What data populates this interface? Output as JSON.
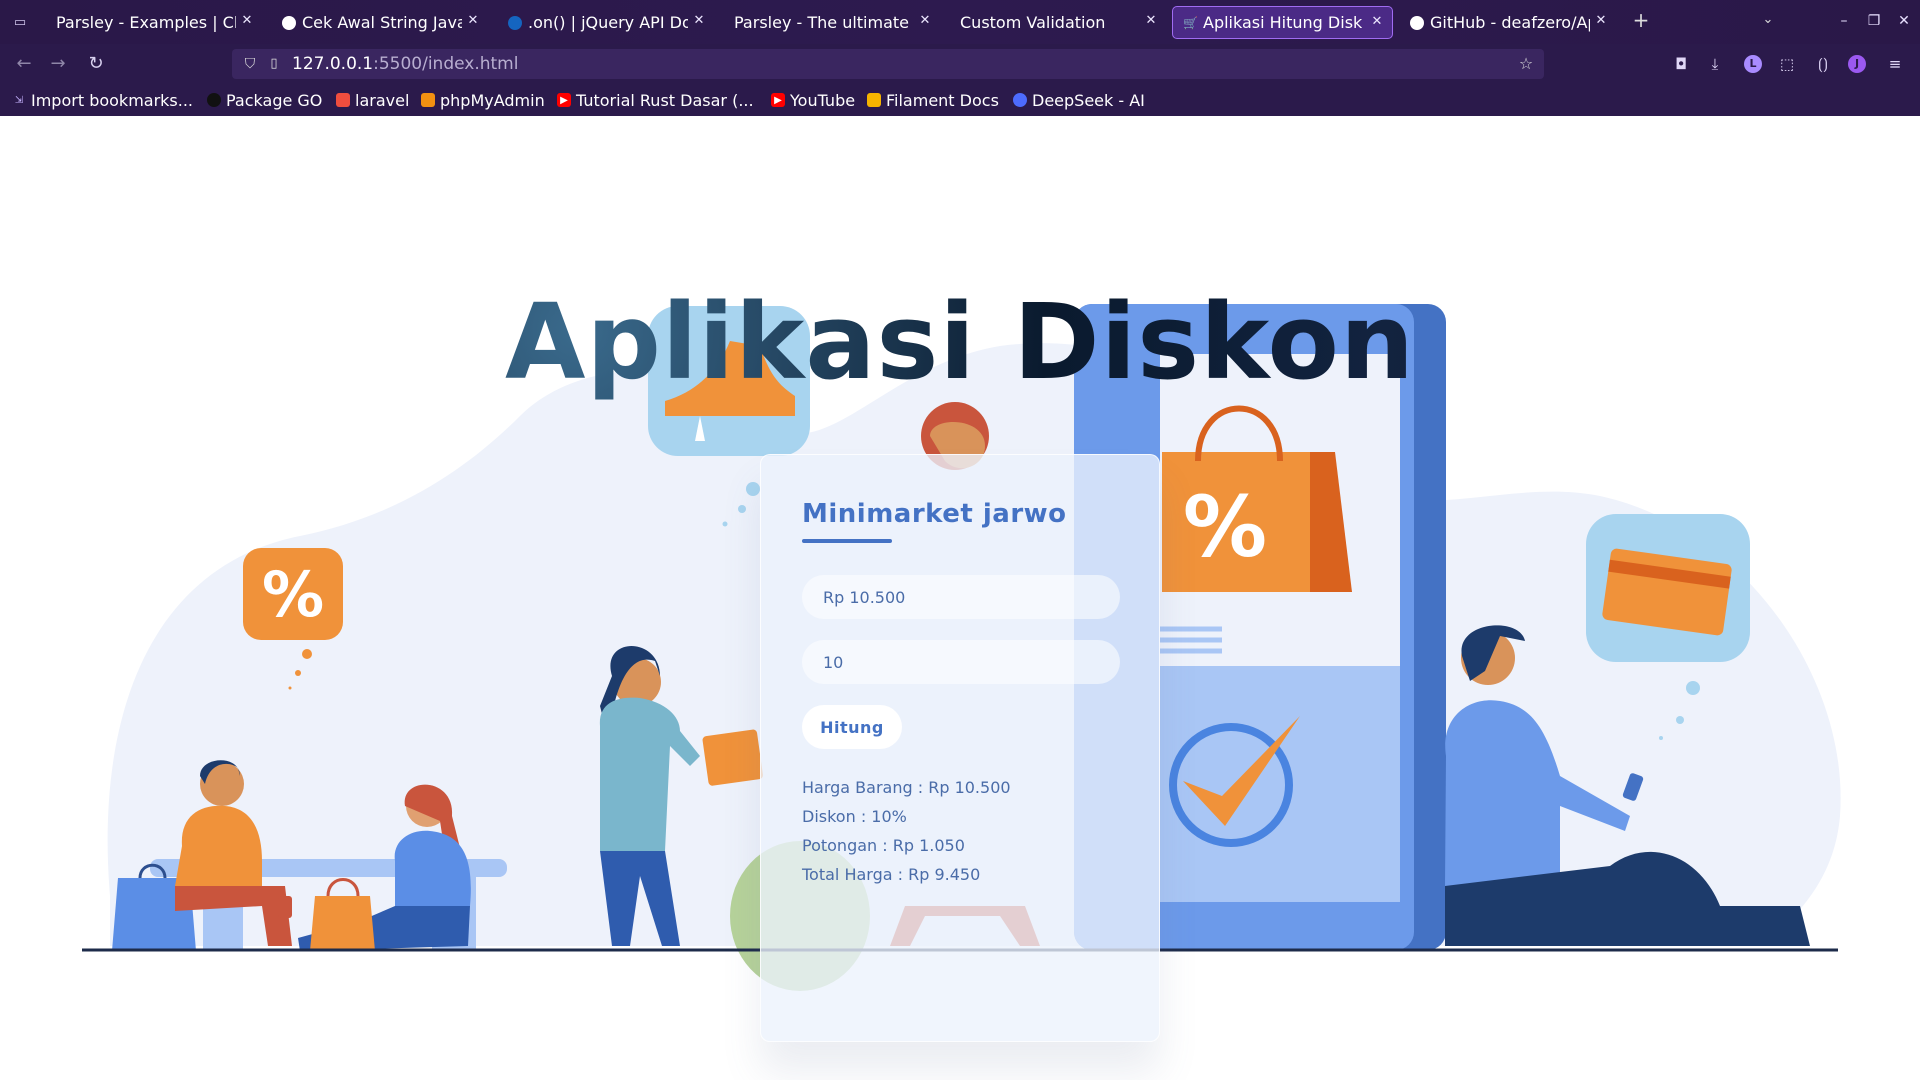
{
  "browser": {
    "tabs": [
      {
        "title": "Parsley - Examples | Cl",
        "icon_color": "#2b1a4b",
        "active": false
      },
      {
        "title": "Cek Awal String Java",
        "icon_color": "#ffffff",
        "active": false
      },
      {
        "title": ".on() | jQuery API Do",
        "icon_color": "#1565c0",
        "active": false
      },
      {
        "title": "Parsley - The ultimate",
        "icon_color": "#2b1a4b",
        "active": false
      },
      {
        "title": "Custom Validation",
        "icon_color": "#2b1a4b",
        "active": false
      },
      {
        "title": "Aplikasi Hitung Disk",
        "icon_color": "#d9c8ff",
        "active": true
      },
      {
        "title": "GitHub - deafzero/Ap",
        "icon_color": "#ffffff",
        "active": false
      }
    ],
    "url": {
      "host": "127.0.0.1",
      "rest": ":5500/index.html"
    },
    "bookmarks": [
      {
        "label": "Import bookmarks...",
        "icon_color": "#8f6fd8"
      },
      {
        "label": "Package GO",
        "icon_color": "#222222"
      },
      {
        "label": "laravel",
        "icon_color": "#f04e3e"
      },
      {
        "label": "phpMyAdmin",
        "icon_color": "#f29111"
      },
      {
        "label": "Tutorial Rust Dasar (...",
        "icon_color": "#ff0000"
      },
      {
        "label": "YouTube",
        "icon_color": "#ff0000"
      },
      {
        "label": "Filament Docs",
        "icon_color": "#f6b400"
      },
      {
        "label": "DeepSeek - AI",
        "icon_color": "#4d6bfe"
      }
    ],
    "colors": {
      "chrome": "#2b1a4b",
      "accent": "#a06cf2"
    }
  },
  "page": {
    "heading": "Aplikasi Diskon",
    "card": {
      "title": "Minimarket jarwo",
      "price_value": "Rp 10.500",
      "discount_value": "10",
      "button_label": "Hitung",
      "results": [
        "Harga Barang : Rp 10.500",
        "Diskon : 10%",
        "Potongan : Rp 1.050",
        "Total Harga : Rp 9.450"
      ]
    },
    "colors": {
      "primary": "#4472c4",
      "orange": "#f0923a",
      "light_blue": "#a8d4ef"
    }
  }
}
